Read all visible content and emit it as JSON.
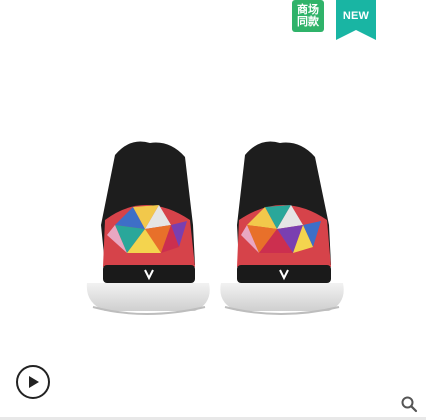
{
  "badges": {
    "mall_line1": "商场",
    "mall_line2": "同款",
    "mall_color": "#2fb36a",
    "new_label": "NEW",
    "new_color": "#19b5a3"
  },
  "media": {
    "image_icon": "sneaker-pair-rear-view",
    "play_icon": "play-icon",
    "search_icon": "search-icon"
  }
}
